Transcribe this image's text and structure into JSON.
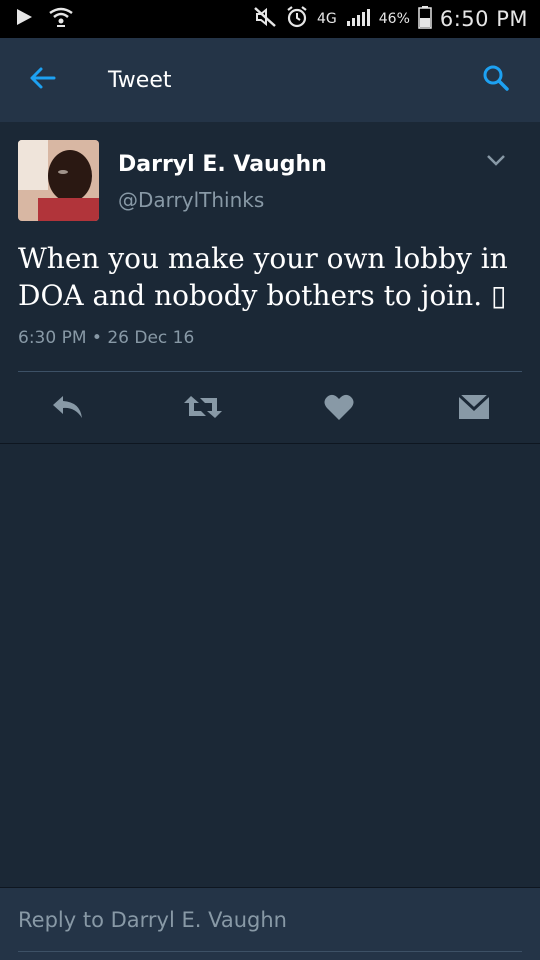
{
  "status_bar": {
    "battery": "46%",
    "network": "4G",
    "time": "6:50 PM"
  },
  "header": {
    "title": "Tweet",
    "icons": [
      "back-arrow-icon",
      "search-icon"
    ],
    "accent": "#1da1f2"
  },
  "tweet": {
    "author_name": "Darryl E. Vaughn",
    "author_handle": "@DarrylThinks",
    "text": "When you make your own lobby in DOA and nobody bothers to join. ▯",
    "timestamp": "6:30 PM • 26 Dec 16",
    "actions": [
      "reply-icon",
      "retweet-icon",
      "like-icon",
      "direct-message-icon"
    ]
  },
  "reply": {
    "placeholder": "Reply to Darryl E. Vaughn"
  },
  "colors": {
    "background": "#1b2836",
    "bar": "#243447",
    "secondary_text": "#8899a6"
  }
}
